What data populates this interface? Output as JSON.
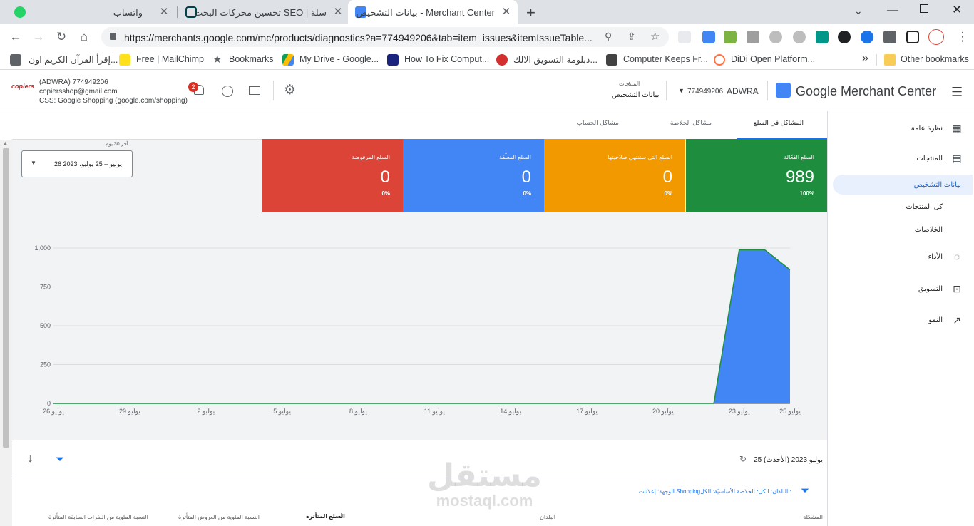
{
  "browser": {
    "tabs": [
      {
        "title": "واتساب"
      },
      {
        "title": "تحسين محركات البحث SEO | سلة"
      },
      {
        "title": "بيانات التشخيص - Merchant Center"
      }
    ],
    "new_tab": "+",
    "url": "https://merchants.google.com/mc/products/diagnostics?a=774949206&tab=item_issues&itemIssueTable...",
    "bookmarks": [
      {
        "label": "إقرأ القرآن الكريم اون..."
      },
      {
        "label": "Free | MailChimp"
      },
      {
        "label": "Bookmarks"
      },
      {
        "label": "My Drive - Google..."
      },
      {
        "label": "How To Fix Comput..."
      },
      {
        "label": "دبلومة التسويق الالك..."
      },
      {
        "label": "Computer Keeps Fr..."
      },
      {
        "label": "DiDi Open Platform..."
      }
    ],
    "bookmarks_more": "»",
    "other_bookmarks": "Other bookmarks"
  },
  "header": {
    "product": "Google Merchant Center",
    "account_name": "ADWRA",
    "account_id": "774949206",
    "breadcrumb_parent": "المنتجات",
    "breadcrumb_current": "بيانات التشخيص",
    "notification_count": "2",
    "user_line1": "(ADWRA) 774949206",
    "user_line2": "copiersshop@gmail.com",
    "user_line3": "CSS: Google Shopping (google.com/shopping)",
    "logo_text": "copiers"
  },
  "sidebar": {
    "items": [
      {
        "label": "نظرة عامة",
        "icon": "dashboard-icon"
      },
      {
        "label": "المنتجات",
        "icon": "list-icon"
      },
      {
        "label": "بيانات التشخيص",
        "icon": ""
      },
      {
        "label": "كل المنتجات",
        "icon": ""
      },
      {
        "label": "الخلاصات",
        "icon": ""
      },
      {
        "label": "الأداء",
        "icon": "performance-icon"
      },
      {
        "label": "التسويق",
        "icon": "shopping-bag-icon"
      },
      {
        "label": "النمو",
        "icon": "trending-up-icon"
      }
    ]
  },
  "main": {
    "tabs": [
      {
        "label": "المشاكل في السلع"
      },
      {
        "label": "مشاكل الخلاصة"
      },
      {
        "label": "مشاكل الحساب"
      }
    ],
    "date_caption": "آخر 30 يوم",
    "date_range": "26 يوليو – 25 يوليو، 2023",
    "cards": [
      {
        "title": "السلع الفعّالة",
        "value": "989",
        "pct": "100%",
        "color": "#1e8e3e"
      },
      {
        "title": "السلع التي ستنتهي صلاحيتها",
        "value": "0",
        "pct": "0%",
        "color": "#f29900"
      },
      {
        "title": "السلع المعلّقة",
        "value": "0",
        "pct": "0%",
        "color": "#4285f4"
      },
      {
        "title": "السلع المرفوضة",
        "value": "0",
        "pct": "0%",
        "color": "#db4437"
      }
    ],
    "last_updated": "25 يوليو 2023 (الأحدث)",
    "filter_text": "الوجهة: إعلانات Shopping؛ البلدان: الكل؛ الخلاصة الأساسيّة: الكل",
    "columns": [
      {
        "label": "المشكلة"
      },
      {
        "label": "البلدان"
      },
      {
        "label": "السلع المتأثرة"
      },
      {
        "label": "النسبة المئوية من العروض المتأثرة"
      },
      {
        "label": "النسبة المئوية من النقرات السابقة المتأثرة"
      }
    ]
  },
  "chart_data": {
    "type": "area",
    "title": "",
    "xlabel": "",
    "ylabel": "",
    "ylim": [
      0,
      1000
    ],
    "yticks": [
      "0",
      "250",
      "500",
      "750",
      "1,000"
    ],
    "xticks": [
      "26 يوليو",
      "29 يوليو",
      "2 يوليو",
      "5 يوليو",
      "8 يوليو",
      "11 يوليو",
      "14 يوليو",
      "17 يوليو",
      "20 يوليو",
      "23 يوليو",
      "25 يوليو"
    ],
    "x": [
      0,
      1,
      2,
      3,
      4,
      5,
      6,
      7,
      8,
      9,
      10,
      11,
      12,
      13,
      14,
      15,
      16,
      17,
      18,
      19,
      20,
      21,
      22,
      23,
      24,
      25,
      26,
      27,
      28,
      29
    ],
    "series": [
      {
        "values": [
          0,
          0,
          0,
          0,
          0,
          0,
          0,
          0,
          0,
          0,
          0,
          0,
          0,
          0,
          0,
          0,
          0,
          0,
          0,
          0,
          0,
          0,
          0,
          0,
          0,
          0,
          0,
          989,
          989,
          860
        ],
        "color": "#4285f4"
      }
    ],
    "grid": true
  },
  "watermark": {
    "ar": "مستقل",
    "en": "mostaql.com"
  }
}
